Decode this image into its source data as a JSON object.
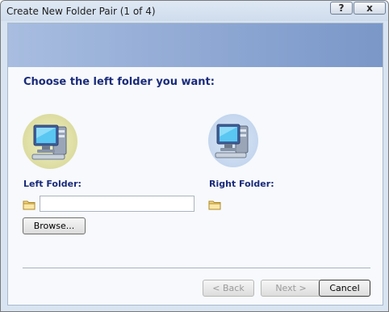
{
  "window": {
    "title": "Create New Folder Pair (1 of 4)",
    "help_glyph": "?",
    "close_glyph": "x"
  },
  "page": {
    "heading": "Choose the left folder you want:",
    "left_label": "Left Folder:",
    "right_label": "Right Folder:",
    "left_input_value": "",
    "browse_label": "Browse..."
  },
  "buttons": {
    "back_label": "< Back",
    "next_label": "Next >",
    "cancel_label": "Cancel"
  },
  "colors": {
    "heading": "#1a2b7a",
    "banner": "#8ca6d2",
    "left_computer_bg": "#dcdca0",
    "right_computer_bg": "#c4d6ee"
  },
  "icons": {
    "left_computer": "computer-icon",
    "right_computer": "computer-icon",
    "left_folder": "folder-icon",
    "right_folder": "folder-icon"
  }
}
